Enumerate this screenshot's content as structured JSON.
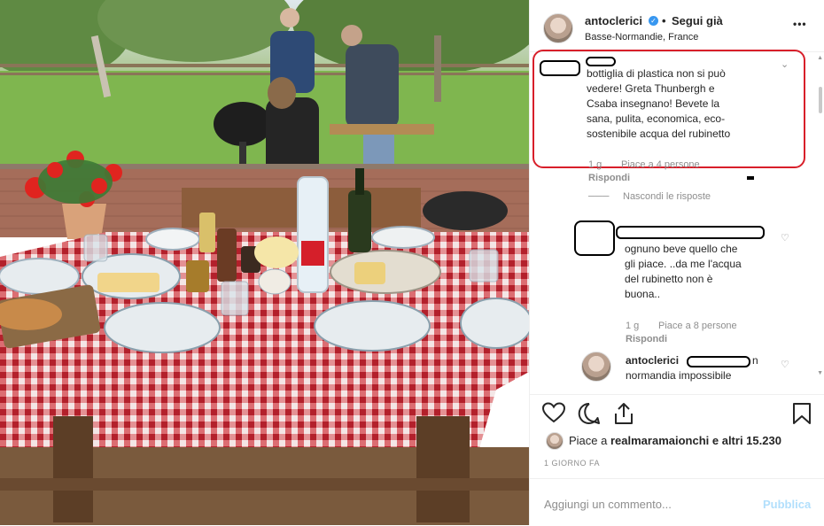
{
  "header": {
    "username": "antoclerici",
    "verified_icon": "verified-badge-icon",
    "follow_label": "Segui già",
    "separator": "•",
    "location": "Basse-Normandie, France",
    "more_label": "•••"
  },
  "comments": [
    {
      "text_lines": [
        "bottiglia di plastica non si può",
        "vedere! Greta Thunbergh e",
        "Csaba insegnano! Bevete la",
        "sana, pulita, economica, eco-",
        "sostenibile acqua del rubinetto"
      ],
      "time": "1 g",
      "likes": "Piace a 4 persone",
      "reply": "Rispondi",
      "hide_replies": "Nascondi le risposte"
    },
    {
      "text_lines": [
        "ognuno beve quello che",
        "gli piace. ..da me l'acqua",
        "del rubinetto non è",
        "buona.."
      ],
      "time": "1 g",
      "likes": "Piace a 8 persone",
      "reply": "Rispondi"
    },
    {
      "username": "antoclerici",
      "text_tail": "n",
      "text_line2": "normandia impossibile"
    }
  ],
  "actions": {
    "like_icon": "heart-icon",
    "comment_icon": "comment-icon",
    "share_icon": "share-icon",
    "save_icon": "bookmark-icon"
  },
  "likes_line": {
    "prefix": "Piace a ",
    "user": "realmaramaionchi",
    "suffix": " e altri 15.230"
  },
  "timestamp": "1 GIORNO FA",
  "add_comment": {
    "placeholder": "Aggiungi un commento...",
    "publish": "Pubblica"
  },
  "colors": {
    "highlight_red": "#d81f2a",
    "link_blue": "#3897f0",
    "publish_disabled": "#b2dffc",
    "tablecloth_red": "#c8102e"
  }
}
